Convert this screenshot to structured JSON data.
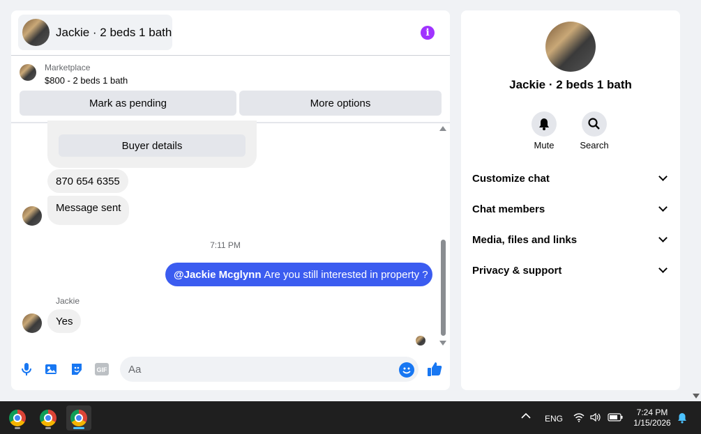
{
  "chat": {
    "header_title": "Jackie · 2 beds 1 bath",
    "listing": {
      "label": "Marketplace",
      "price_title": "$800 - 2 beds 1 bath"
    },
    "actions": {
      "mark_pending": "Mark as pending",
      "more_options": "More options"
    },
    "messages": {
      "buyer_details_button": "Buyer details",
      "phone": "870 654 6355",
      "message_sent": "Message sent",
      "timestamp": "7:11 PM",
      "outgoing_mention": "@Jackie Mcglynn",
      "outgoing_text": "Are you still interested in property ?",
      "sender_name": "Jackie",
      "reply": "Yes"
    },
    "composer": {
      "placeholder": "Aa"
    },
    "icons": [
      "microphone-icon",
      "photo-icon",
      "sticker-icon",
      "gif-icon",
      "emoji-icon",
      "thumbs-up-icon",
      "info-icon"
    ],
    "gif_label": "GIF"
  },
  "side": {
    "title": "Jackie · 2 beds 1 bath",
    "mute_label": "Mute",
    "search_label": "Search",
    "sections": [
      "Customize chat",
      "Chat members",
      "Media, files and links",
      "Privacy & support"
    ]
  },
  "taskbar": {
    "language": "ENG",
    "time": "7:24 PM",
    "date": "1/15/2026"
  },
  "colors": {
    "accent": "#3b5cf0",
    "info": "#a033ff",
    "messenger_blue": "#1877f2"
  }
}
